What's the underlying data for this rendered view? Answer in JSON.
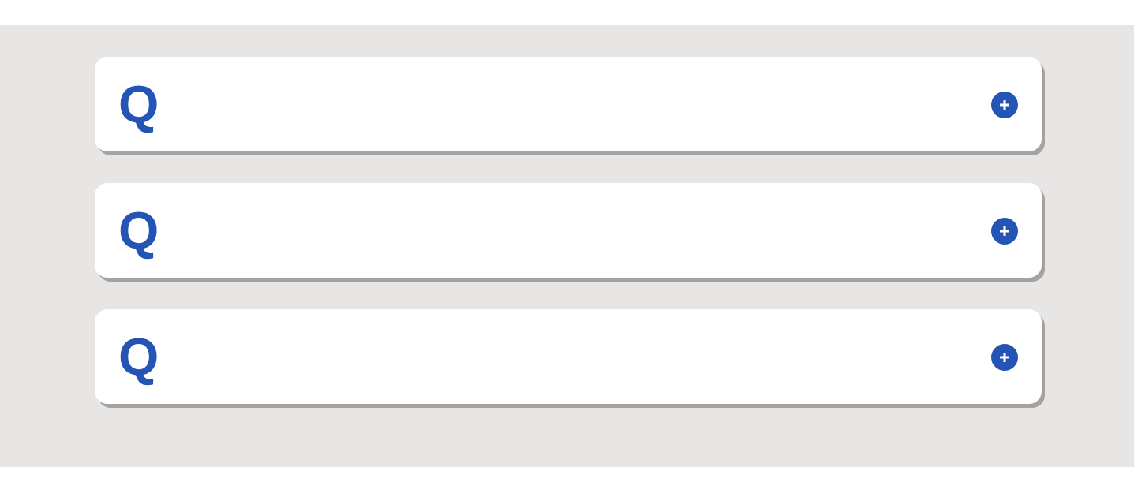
{
  "faq_items": [
    {
      "question_mark": "Q",
      "expanded": false
    },
    {
      "question_mark": "Q",
      "expanded": false
    },
    {
      "question_mark": "Q",
      "expanded": false
    }
  ]
}
